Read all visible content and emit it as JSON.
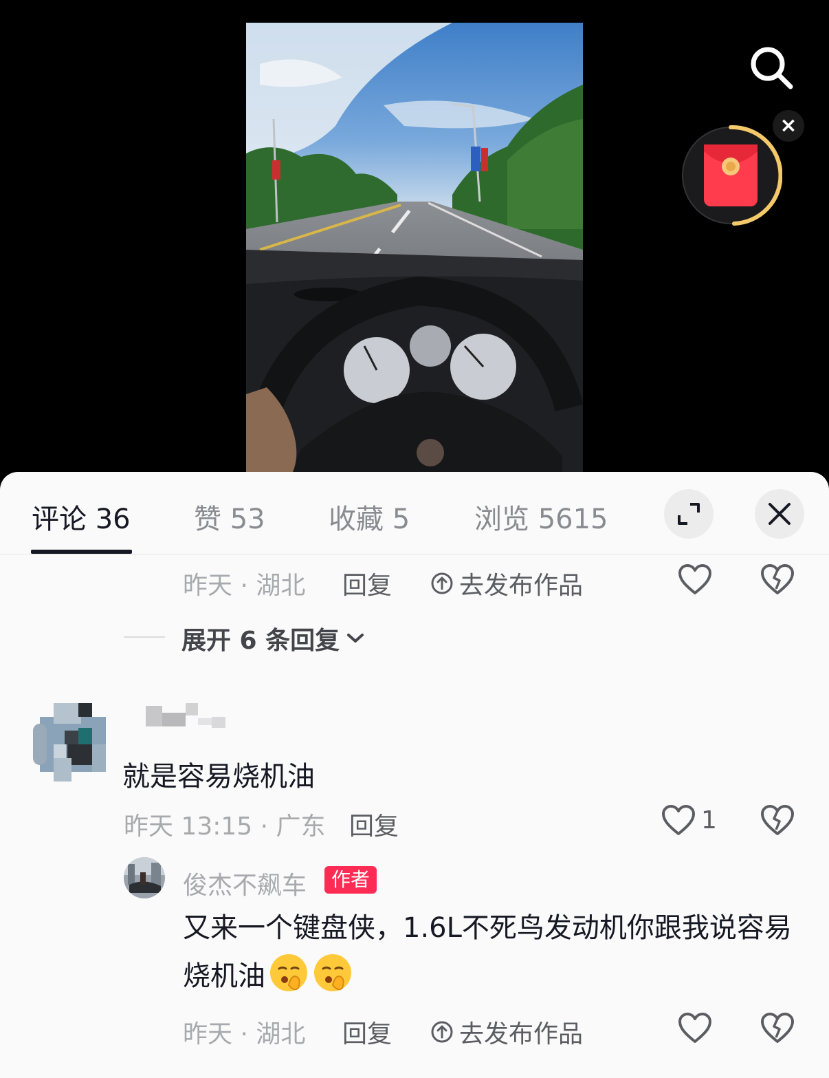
{
  "tabs": [
    {
      "label": "评论 36",
      "active": true
    },
    {
      "label": "赞 53",
      "active": false
    },
    {
      "label": "收藏 5",
      "active": false
    },
    {
      "label": "浏览 5615",
      "active": false
    }
  ],
  "icons": {
    "search": "search-icon",
    "red_packet": "red-packet-icon",
    "close_small": "close-icon",
    "expand": "expand-icon",
    "close": "close-icon",
    "like": "heart-icon",
    "dislike": "broken-heart-icon",
    "publish": "upload-icon",
    "chevron": "chevron-down-icon",
    "emoji": "shush-face-emoji"
  },
  "colors": {
    "accent": "#fe2c55",
    "text_primary": "#161823",
    "text_secondary": "#a8a9ad",
    "timer_ring": "#f4c96a"
  },
  "red_packet_close": "×",
  "first_thread": {
    "meta": "昨天 · 湖北",
    "reply_label": "回复",
    "publish_label": "去发布作品",
    "expand_label": "展开 6 条回复"
  },
  "comment": {
    "text": "就是容易烧机油",
    "meta": "昨天 13:15 · 广东",
    "reply_label": "回复",
    "like_count": "1"
  },
  "author_reply": {
    "username": "俊杰不飙车",
    "badge": "作者",
    "text": "又来一个键盘侠，1.6L不死鸟发动机你跟我说容易烧机油",
    "meta": "昨天 · 湖北",
    "reply_label": "回复",
    "publish_label": "去发布作品"
  }
}
